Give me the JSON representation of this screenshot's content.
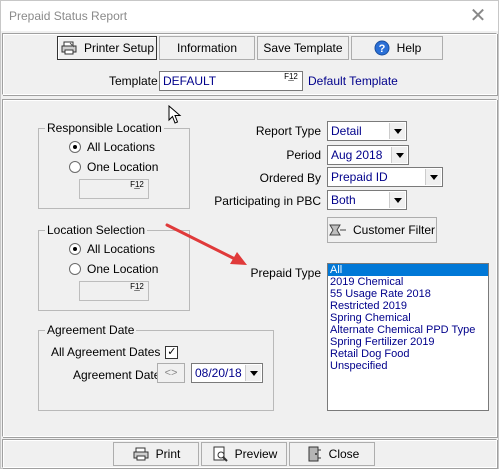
{
  "window": {
    "title": "Prepaid Status Report",
    "close_glyph": "✕"
  },
  "toolbar": {
    "printer_setup": "Printer Setup",
    "information": "Information",
    "save_template": "Save Template",
    "help": "Help"
  },
  "template": {
    "label": "Template",
    "value": "DEFAULT",
    "f12": "F12",
    "description": "Default Template"
  },
  "responsible_location": {
    "legend": "Responsible Location",
    "all": "All Locations",
    "one": "One Location",
    "selected": "all",
    "f12": "F12"
  },
  "location_selection": {
    "legend": "Location Selection",
    "all": "All Locations",
    "one": "One Location",
    "selected": "all",
    "f12": "F12"
  },
  "agreement_date": {
    "legend": "Agreement Date",
    "all_label": "All Agreement Dates",
    "all_checked": true,
    "check_glyph": "✓",
    "date_label": "Agreement Date",
    "compare_btn": "<>",
    "date_value": "08/20/18"
  },
  "options": {
    "report_type_label": "Report Type",
    "report_type_value": "Detail",
    "period_label": "Period",
    "period_value": "Aug 2018",
    "ordered_by_label": "Ordered By",
    "ordered_by_value": "Prepaid ID",
    "pbc_label": "Participating in PBC",
    "pbc_value": "Both",
    "customer_filter": "Customer Filter"
  },
  "prepaid_type": {
    "label": "Prepaid Type",
    "items": [
      "All",
      "2019 Chemical",
      "55 Usage Rate 2018",
      "Restricted 2019",
      "Spring Chemical",
      "Alternate Chemical PPD Type",
      "Spring Fertilizer 2019",
      "Retail Dog Food",
      "Unspecified"
    ],
    "selected_index": 0
  },
  "footer": {
    "print": "Print",
    "preview": "Preview",
    "close": "Close"
  },
  "annotation": {
    "arrow_color": "#e03a3a"
  }
}
